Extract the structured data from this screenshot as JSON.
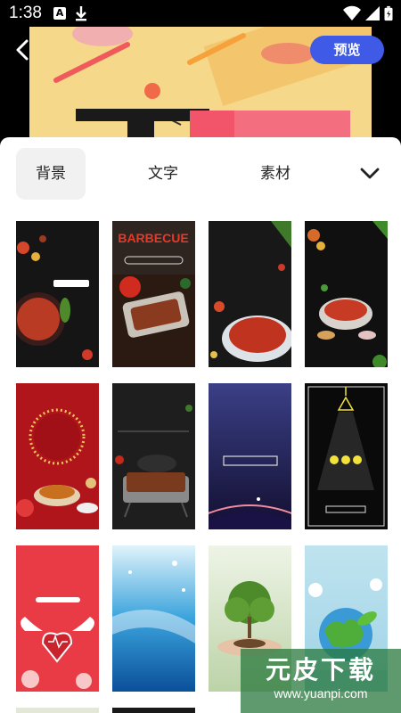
{
  "status_bar": {
    "time": "1:38",
    "a_label": "A"
  },
  "header": {
    "preview_label": "预览"
  },
  "tabs": [
    {
      "label": "背景",
      "active": true
    },
    {
      "label": "文字",
      "active": false
    },
    {
      "label": "素材",
      "active": false
    }
  ],
  "thumbnails": [
    {
      "id": 1,
      "text": ""
    },
    {
      "id": 2,
      "text": "BARBECUE"
    },
    {
      "id": 3,
      "text": ""
    },
    {
      "id": 4,
      "text": ""
    },
    {
      "id": 5,
      "text": ""
    },
    {
      "id": 6,
      "text": ""
    },
    {
      "id": 7,
      "text": ""
    },
    {
      "id": 8,
      "text": ""
    },
    {
      "id": 9,
      "text": ""
    },
    {
      "id": 10,
      "text": ""
    },
    {
      "id": 11,
      "text": ""
    },
    {
      "id": 12,
      "text": ""
    }
  ],
  "watermark": {
    "title": "元皮下载",
    "url": "www.yuanpi.com"
  },
  "colors": {
    "accent": "#3e5ae6",
    "poster_bg": "#f6d88a"
  }
}
